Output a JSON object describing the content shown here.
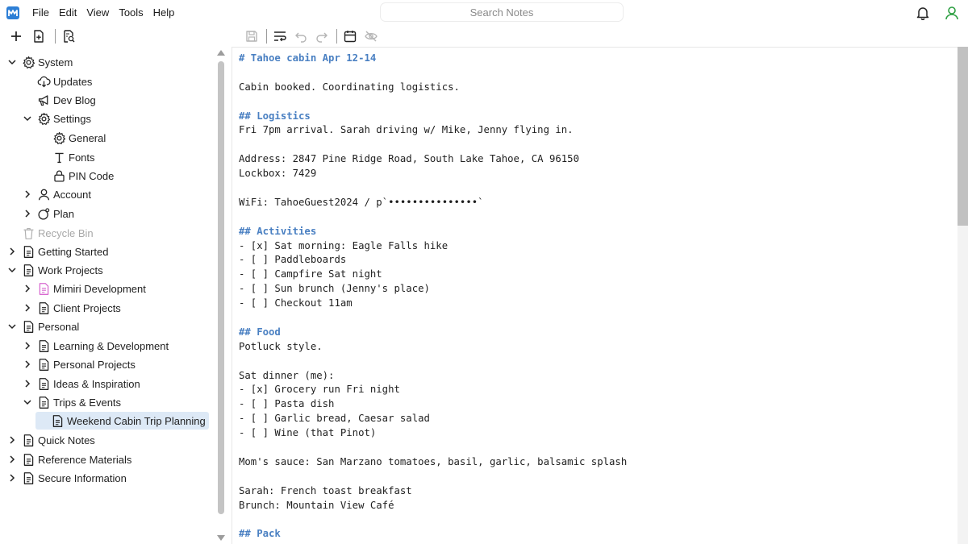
{
  "menu": [
    "File",
    "Edit",
    "View",
    "Tools",
    "Help"
  ],
  "search": {
    "placeholder": "Search Notes"
  },
  "sidebar": {
    "items": [
      {
        "label": "System",
        "icon": "gear-icon",
        "chevron": "down",
        "level": 0
      },
      {
        "label": "Updates",
        "icon": "cloud-download-icon",
        "chevron": "none",
        "level": 1
      },
      {
        "label": "Dev Blog",
        "icon": "megaphone-icon",
        "chevron": "none",
        "level": 1
      },
      {
        "label": "Settings",
        "icon": "gear-icon",
        "chevron": "down",
        "level": 1
      },
      {
        "label": "General",
        "icon": "gear-icon",
        "chevron": "none",
        "level": 2
      },
      {
        "label": "Fonts",
        "icon": "text-t-icon",
        "chevron": "none",
        "level": 2
      },
      {
        "label": "PIN Code",
        "icon": "lock-icon",
        "chevron": "none",
        "level": 2
      },
      {
        "label": "Account",
        "icon": "user-icon",
        "chevron": "right",
        "level": 1
      },
      {
        "label": "Plan",
        "icon": "plan-circle-icon",
        "chevron": "right",
        "level": 1
      },
      {
        "label": "Recycle Bin",
        "icon": "trash-icon",
        "chevron": "none",
        "level": 0,
        "disabled": true
      },
      {
        "label": "Getting Started",
        "icon": "document-icon",
        "chevron": "right",
        "level": 0
      },
      {
        "label": "Work Projects",
        "icon": "document-icon",
        "chevron": "down",
        "level": 0
      },
      {
        "label": "Mimiri Development",
        "icon": "document-pink-icon",
        "chevron": "right",
        "level": 1
      },
      {
        "label": "Client Projects",
        "icon": "document-icon",
        "chevron": "right",
        "level": 1
      },
      {
        "label": "Personal",
        "icon": "document-icon",
        "chevron": "down",
        "level": 0
      },
      {
        "label": "Learning & Development",
        "icon": "document-icon",
        "chevron": "right",
        "level": 1
      },
      {
        "label": "Personal Projects",
        "icon": "document-icon",
        "chevron": "right",
        "level": 1
      },
      {
        "label": "Ideas & Inspiration",
        "icon": "document-icon",
        "chevron": "right",
        "level": 1
      },
      {
        "label": "Trips & Events",
        "icon": "document-icon",
        "chevron": "down",
        "level": 1
      },
      {
        "label": "Weekend Cabin Trip Planning",
        "icon": "document-icon",
        "chevron": "none",
        "level": 2,
        "selected": true
      },
      {
        "label": "Quick Notes",
        "icon": "document-icon",
        "chevron": "right",
        "level": 0
      },
      {
        "label": "Reference Materials",
        "icon": "document-icon",
        "chevron": "right",
        "level": 0
      },
      {
        "label": "Secure Information",
        "icon": "document-icon",
        "chevron": "right",
        "level": 0
      }
    ]
  },
  "editor": {
    "lines": [
      "# Tahoe cabin Apr 12-14",
      "",
      "Cabin booked. Coordinating logistics.",
      "",
      "## Logistics",
      "Fri 7pm arrival. Sarah driving w/ Mike, Jenny flying in.",
      "",
      "Address: 2847 Pine Ridge Road, South Lake Tahoe, CA 96150",
      "Lockbox: 7429",
      "",
      "WiFi: TahoeGuest2024 / p`•••••••••••••••`",
      "",
      "## Activities",
      "- [x] Sat morning: Eagle Falls hike",
      "- [ ] Paddleboards",
      "- [ ] Campfire Sat night",
      "- [ ] Sun brunch (Jenny's place)",
      "- [ ] Checkout 11am",
      "",
      "## Food",
      "Potluck style.",
      "",
      "Sat dinner (me):",
      "- [x] Grocery run Fri night",
      "- [ ] Pasta dish",
      "- [ ] Garlic bread, Caesar salad",
      "- [ ] Wine (that Pinot)",
      "",
      "Mom's sauce: San Marzano tomatoes, basil, garlic, balsamic splash",
      "",
      "Sarah: French toast breakfast",
      "Brunch: Mountain View Café",
      "",
      "## Pack"
    ]
  },
  "colors": {
    "accent": "#2d7fd6",
    "heading": "#4a80c2",
    "selection": "#dde9f6",
    "online": "#2ea043"
  }
}
